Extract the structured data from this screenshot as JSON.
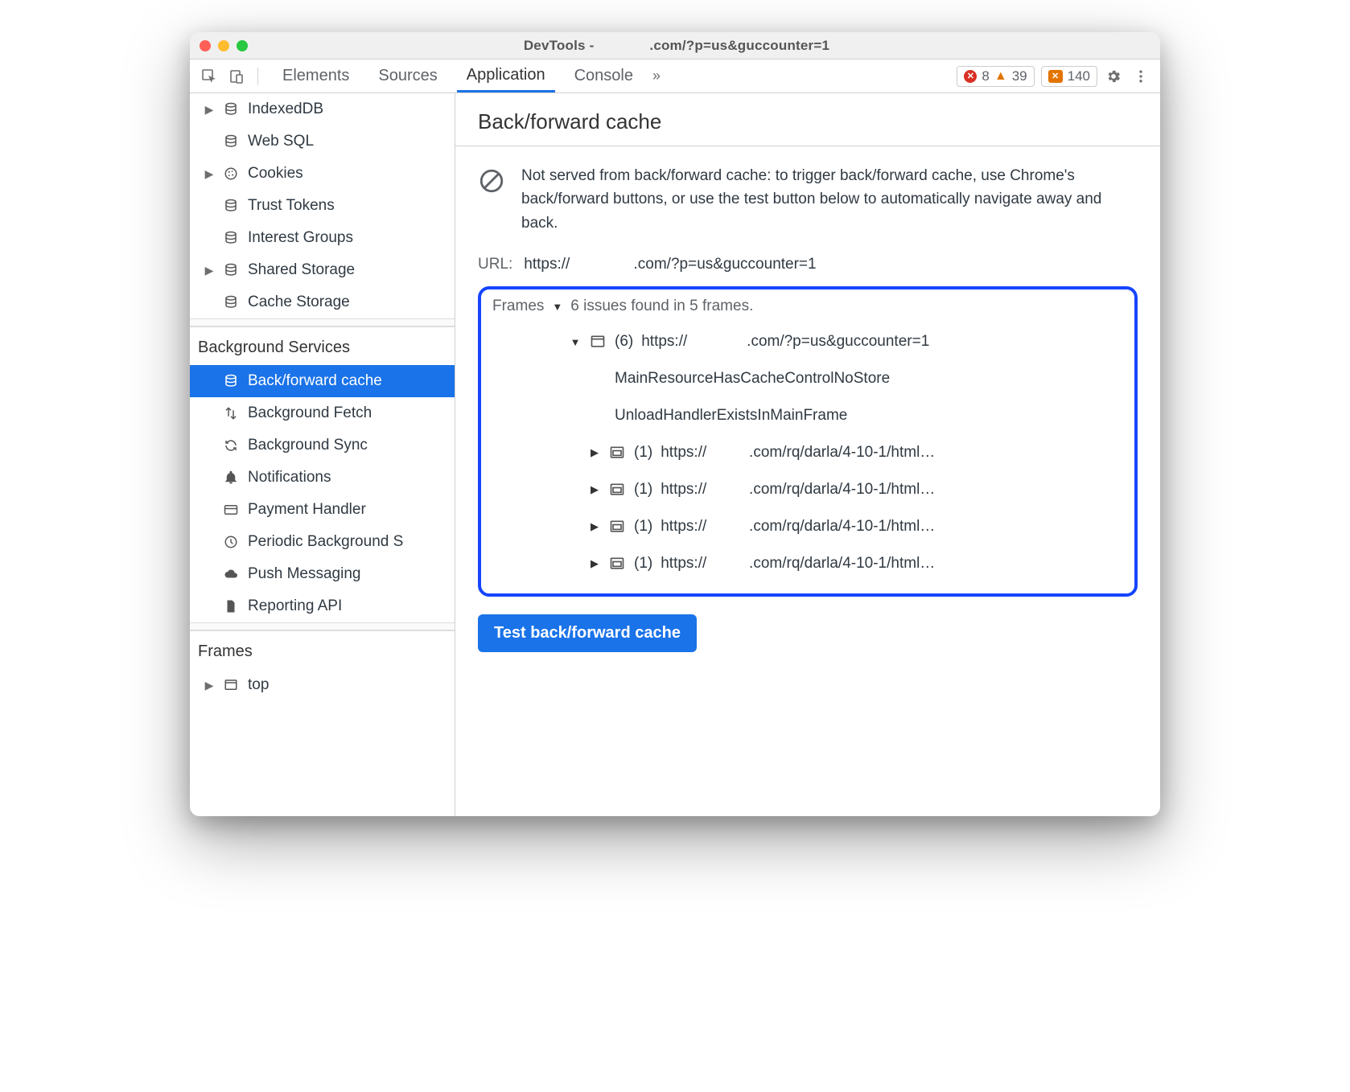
{
  "window": {
    "title": "DevTools -              .com/?p=us&guccounter=1"
  },
  "toolbar": {
    "tabs": [
      "Elements",
      "Sources",
      "Application",
      "Console"
    ],
    "active_index": 2,
    "overflow_glyph": "»",
    "errors": "8",
    "warnings": "39",
    "messages": "140"
  },
  "sidebar": {
    "storage_items": [
      {
        "label": "IndexedDB",
        "icon": "db",
        "expandable": true
      },
      {
        "label": "Web SQL",
        "icon": "db",
        "expandable": false
      },
      {
        "label": "Cookies",
        "icon": "cookie",
        "expandable": true
      },
      {
        "label": "Trust Tokens",
        "icon": "db",
        "expandable": false
      },
      {
        "label": "Interest Groups",
        "icon": "db",
        "expandable": false
      },
      {
        "label": "Shared Storage",
        "icon": "db",
        "expandable": true
      },
      {
        "label": "Cache Storage",
        "icon": "db",
        "expandable": false
      }
    ],
    "bg_title": "Background Services",
    "bg_items": [
      {
        "label": "Back/forward cache",
        "icon": "db",
        "selected": true
      },
      {
        "label": "Background Fetch",
        "icon": "fetch"
      },
      {
        "label": "Background Sync",
        "icon": "sync"
      },
      {
        "label": "Notifications",
        "icon": "bell"
      },
      {
        "label": "Payment Handler",
        "icon": "card"
      },
      {
        "label": "Periodic Background S",
        "icon": "clock"
      },
      {
        "label": "Push Messaging",
        "icon": "cloud"
      },
      {
        "label": "Reporting API",
        "icon": "file"
      }
    ],
    "frames_title": "Frames",
    "frames_items": [
      {
        "label": "top",
        "icon": "window",
        "expandable": true
      }
    ]
  },
  "main": {
    "title": "Back/forward cache",
    "info": "Not served from back/forward cache: to trigger back/forward cache, use Chrome's back/forward buttons, or use the test button below to automatically navigate away and back.",
    "url_label": "URL:",
    "url_value": "https://               .com/?p=us&guccounter=1",
    "frames_label": "Frames",
    "frames_summary": "6 issues found in 5 frames.",
    "root_frame": {
      "count": "(6)",
      "url": "https://              .com/?p=us&guccounter=1",
      "reasons": [
        "MainResourceHasCacheControlNoStore",
        "UnloadHandlerExistsInMainFrame"
      ]
    },
    "child_frames": [
      {
        "count": "(1)",
        "url": "https://          .com/rq/darla/4-10-1/html…"
      },
      {
        "count": "(1)",
        "url": "https://          .com/rq/darla/4-10-1/html…"
      },
      {
        "count": "(1)",
        "url": "https://          .com/rq/darla/4-10-1/html…"
      },
      {
        "count": "(1)",
        "url": "https://          .com/rq/darla/4-10-1/html…"
      }
    ],
    "test_button": "Test back/forward cache"
  }
}
